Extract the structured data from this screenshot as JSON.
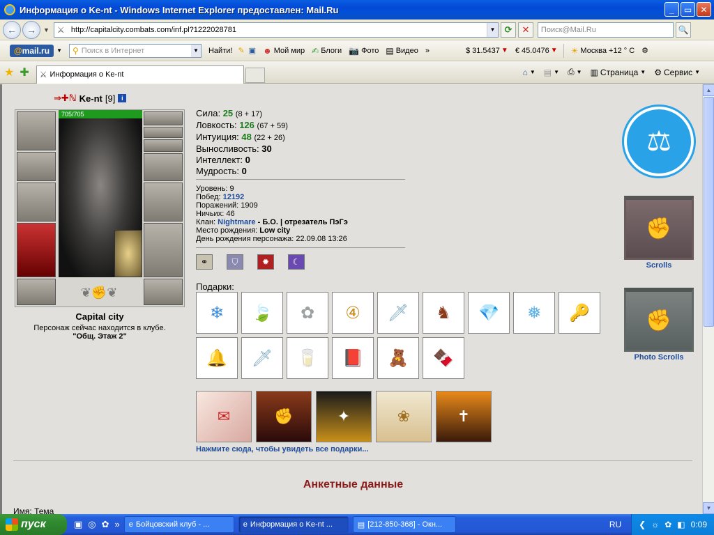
{
  "window": {
    "title": "Информация о Ke-nt - Windows Internet Explorer предоставлен: Mail.Ru",
    "minimize": "_",
    "maximize": "▭",
    "close": "✕"
  },
  "address": {
    "back": "←",
    "forward": "→",
    "url": "http://capitalcity.combats.com/inf.pl?1222028781",
    "refresh": "⟳",
    "stop": "✕",
    "search_placeholder": "Поиск@Mail.Ru",
    "search_go": "🔍"
  },
  "mailbar": {
    "logo_at": "@",
    "logo_text": "mail.ru",
    "search_placeholder": "Поиск в Интернет",
    "find": "Найти!",
    "items": [
      "Мой мир",
      "Блоги",
      "Фото",
      "Видео"
    ],
    "more": "»",
    "usd": "$ 31.5437",
    "eur": "€ 45.0476",
    "weather": "Москва +12 ° C"
  },
  "tabs": {
    "active_label": "Информация о Ke-nt",
    "commands": [
      "Страница",
      "Сервис"
    ]
  },
  "character": {
    "name": "Ke-nt",
    "level": "[9]",
    "hp": "705/705",
    "city": "Capital city",
    "location_text": "Персонаж сейчас находится в клубе.",
    "room": "\"Общ. Этаж 2\""
  },
  "stats": [
    {
      "label": "Сила:",
      "value": "25",
      "extra": "(8 + 17)",
      "style": "v"
    },
    {
      "label": "Ловкость:",
      "value": "126",
      "extra": "(67 + 59)",
      "style": "v"
    },
    {
      "label": "Интуиция:",
      "value": "48",
      "extra": "(22 + 26)",
      "style": "v"
    },
    {
      "label": "Выносливость:",
      "value": "30",
      "extra": "",
      "style": "vb"
    },
    {
      "label": "Интеллект:",
      "value": "0",
      "extra": "",
      "style": "vb"
    },
    {
      "label": "Мудрость:",
      "value": "0",
      "extra": "",
      "style": "vb"
    }
  ],
  "info": {
    "level_label": "Уровень:",
    "level": "9",
    "wins_label": "Побед:",
    "wins": "12192",
    "losses_label": "Поражений:",
    "losses": "1909",
    "draws_label": "Ничьих:",
    "draws": "46",
    "clan_label": "Клан:",
    "clan": "Nightmare",
    "clan_rank": "- Б.О. | отрезатель ПэГэ",
    "birthplace_label": "Место рождения:",
    "birthplace": "Low city",
    "birthday_label": "День рождения персонажа:",
    "birthday": "22.09.08 13:26"
  },
  "gifts": {
    "label": "Подарки:",
    "row1": [
      "❄",
      "🍃",
      "✿",
      "④",
      "🗡",
      "♞",
      "💎",
      "❅",
      "🔑"
    ],
    "row2": [
      "🔔",
      "🗡",
      "🥛",
      "📕",
      "🧸",
      "🍫"
    ],
    "see_all": "Нажмите сюда, чтобы увидеть все подарки..."
  },
  "side": {
    "justice_icon": "⚖",
    "scrolls_label": "Scrolls",
    "photo_label": "Photo Scrolls"
  },
  "anketa": {
    "title": "Анкетные данные",
    "name_label": "Имя:",
    "name_value": "Тема"
  },
  "taskbar": {
    "start": "пуск",
    "tasks": [
      "Бойцовский клуб - ...",
      "Информация о Ke-nt ...",
      "[212-850-368] - Окн..."
    ],
    "lang": "RU",
    "time": "0:09"
  }
}
